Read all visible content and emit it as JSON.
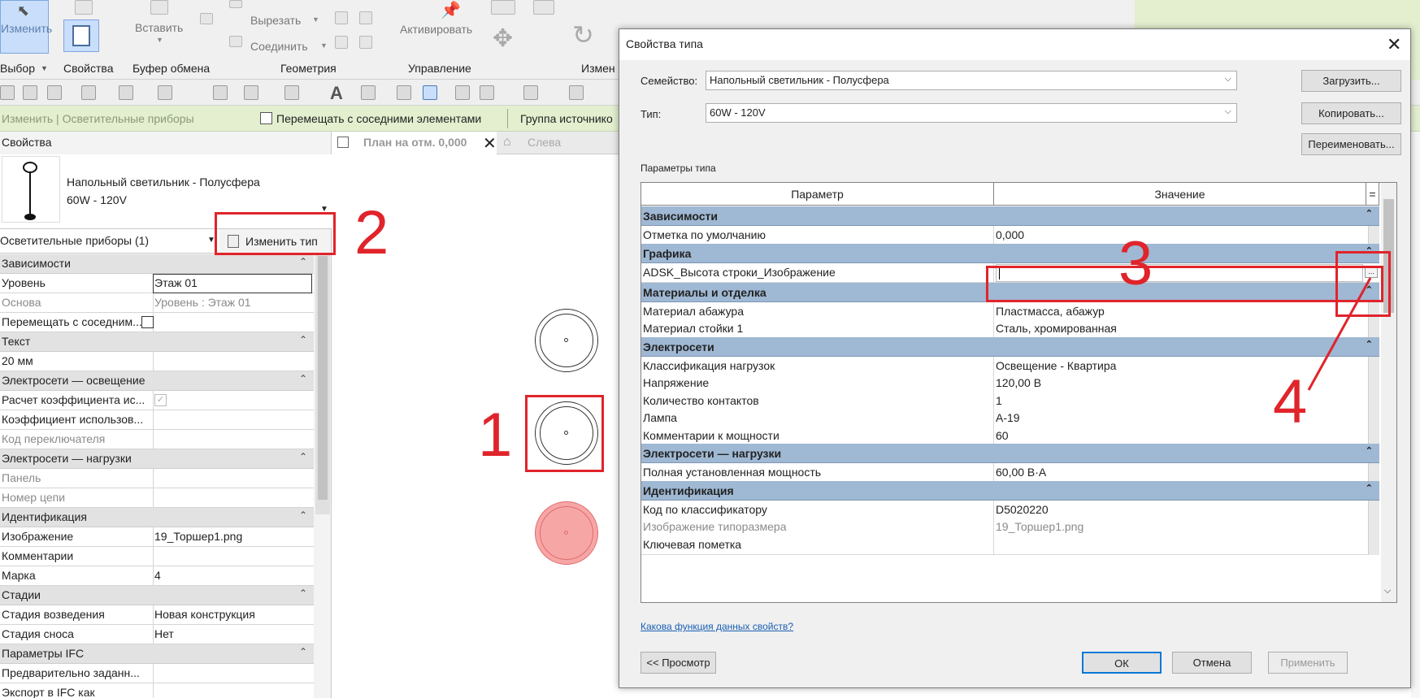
{
  "ribbon": {
    "modify_label": "Изменить",
    "paste_label": "Вставить",
    "cut_label": "Вырезать",
    "join_label": "Соединить",
    "activate_label": "Активировать",
    "groups": [
      "Выбор",
      "Свойства",
      "Буфер обмена",
      "Геометрия",
      "Управление",
      "Измен"
    ]
  },
  "context_bar": {
    "mode": "Изменить | Осветительные приборы",
    "move_with_neighbors": "Перемещать с соседними элементами",
    "source_group": "Группа источнико"
  },
  "palette": {
    "title": "Свойства",
    "family_line1": "Напольный светильник - Полусфера",
    "family_line2": "60W - 120V",
    "category": "Осветительные приборы (1)",
    "edit_type_label": "Изменить тип",
    "rows": [
      {
        "type": "header",
        "label": "Зависимости"
      },
      {
        "type": "row",
        "key": "Уровень",
        "value": "Этаж 01",
        "boxed": true
      },
      {
        "type": "row",
        "key": "Основа",
        "value": "Уровень : Этаж 01",
        "muted": true
      },
      {
        "type": "row",
        "key": "Перемещать с соседним...",
        "value": "",
        "checkbox": true
      },
      {
        "type": "header",
        "label": "Текст"
      },
      {
        "type": "row",
        "key": "20 мм",
        "value": ""
      },
      {
        "type": "header",
        "label": "Электросети — освещение"
      },
      {
        "type": "row",
        "key": "Расчет коэффициента ис...",
        "value": "",
        "checkbox": true,
        "checked": true
      },
      {
        "type": "row",
        "key": "Коэффициент использов...",
        "value": ""
      },
      {
        "type": "row",
        "key": "Код переключателя",
        "value": "",
        "muted": true
      },
      {
        "type": "header",
        "label": "Электросети — нагрузки"
      },
      {
        "type": "row",
        "key": "Панель",
        "value": "",
        "muted": true
      },
      {
        "type": "row",
        "key": "Номер цепи",
        "value": "",
        "muted": true
      },
      {
        "type": "header",
        "label": "Идентификация"
      },
      {
        "type": "row",
        "key": "Изображение",
        "value": "19_Торшер1.png"
      },
      {
        "type": "row",
        "key": "Комментарии",
        "value": ""
      },
      {
        "type": "row",
        "key": "Марка",
        "value": "4"
      },
      {
        "type": "header",
        "label": "Стадии"
      },
      {
        "type": "row",
        "key": "Стадия возведения",
        "value": "Новая конструкция"
      },
      {
        "type": "row",
        "key": "Стадия сноса",
        "value": "Нет"
      },
      {
        "type": "header",
        "label": "Параметры IFC"
      },
      {
        "type": "row",
        "key": "Предварительно заданн...",
        "value": ""
      },
      {
        "type": "row",
        "key": "Экспорт в IFC как",
        "value": ""
      }
    ]
  },
  "view": {
    "active_tab": "План на отм. 0,000",
    "inactive_tab": "Слева"
  },
  "dialog": {
    "title": "Свойства типа",
    "family_label": "Семейство:",
    "family_value": "Напольный светильник - Полусфера",
    "type_label": "Тип:",
    "type_value": "60W - 120V",
    "load_button": "Загрузить...",
    "copy_button": "Копировать...",
    "rename_button": "Переименовать...",
    "params_label": "Параметры типа",
    "col_param": "Параметр",
    "col_value": "Значение",
    "col_eq": "=",
    "rows": [
      {
        "type": "header",
        "label": "Зависимости"
      },
      {
        "type": "row",
        "key": "Отметка по умолчанию",
        "value": "0,000"
      },
      {
        "type": "header",
        "label": "Графика"
      },
      {
        "type": "row",
        "key": "ADSK_Высота строки_Изображение",
        "value": "",
        "editing": true
      },
      {
        "type": "header",
        "label": "Материалы и отделка"
      },
      {
        "type": "row",
        "key": "Материал абажура",
        "value": "Пластмасса, абажур"
      },
      {
        "type": "row",
        "key": "Материал стойки 1",
        "value": "Сталь, хромированная"
      },
      {
        "type": "header",
        "label": "Электросети"
      },
      {
        "type": "row",
        "key": "Классификация нагрузок",
        "value": "Освещение - Квартира"
      },
      {
        "type": "row",
        "key": "Напряжение",
        "value": "120,00 В"
      },
      {
        "type": "row",
        "key": "Количество контактов",
        "value": "1"
      },
      {
        "type": "row",
        "key": "Лампа",
        "value": "A-19"
      },
      {
        "type": "row",
        "key": "Комментарии к мощности",
        "value": "60"
      },
      {
        "type": "header",
        "label": "Электросети — нагрузки"
      },
      {
        "type": "row",
        "key": "Полная установленная мощность",
        "value": "60,00 В·А"
      },
      {
        "type": "header",
        "label": "Идентификация"
      },
      {
        "type": "row",
        "key": "Код по классификатору",
        "value": "D5020220"
      },
      {
        "type": "row",
        "key": "Изображение типоразмера",
        "value": "19_Торшер1.png",
        "muted": true
      },
      {
        "type": "row",
        "key": "Ключевая пометка",
        "value": ""
      }
    ],
    "help_link": "Какова функция данных свойств?",
    "preview_button": "<< Просмотр",
    "ok_button": "ОК",
    "cancel_button": "Отмена",
    "apply_button": "Применить"
  },
  "annotations": [
    "1",
    "2",
    "3",
    "4"
  ],
  "colors": {
    "annotation": "#e0242b",
    "section_header": "#9fb8d3",
    "context_bar": "#e3efcf",
    "selection": "#f7a6a6"
  }
}
